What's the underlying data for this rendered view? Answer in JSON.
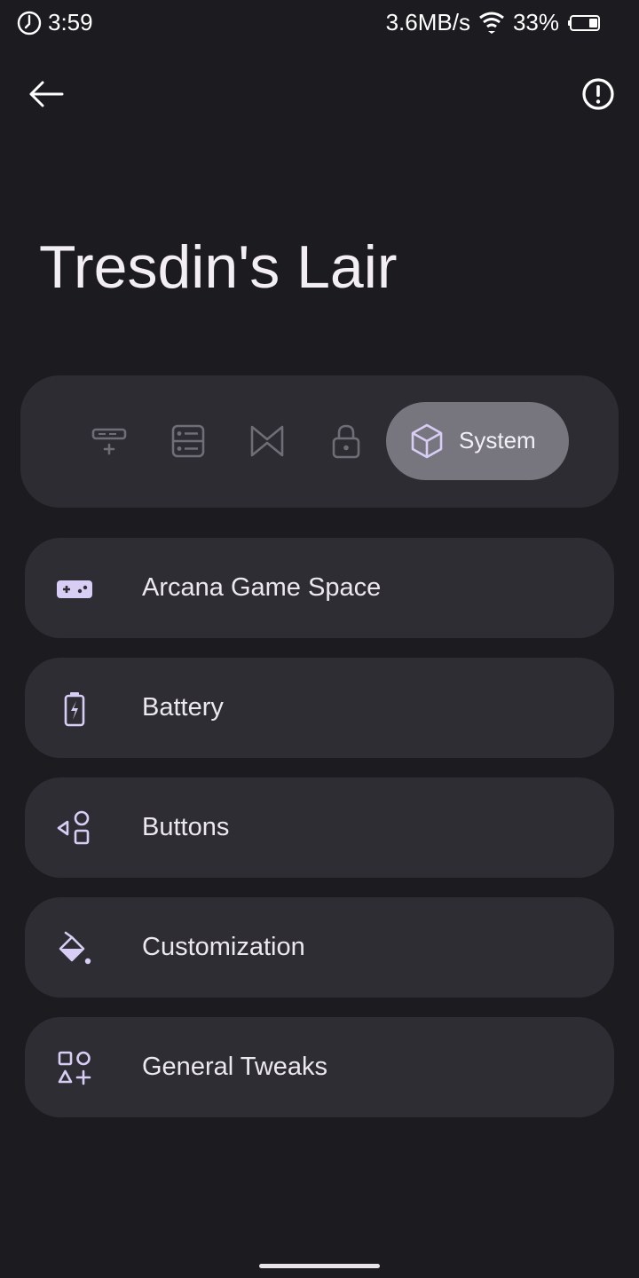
{
  "status_bar": {
    "time": "3:59",
    "network_speed": "3.6MB/s",
    "battery_percent": "33%",
    "battery_level": 0.33
  },
  "app_bar": {
    "back_icon": "arrow-left-icon",
    "info_icon": "info-circle-icon"
  },
  "page": {
    "title": "Tresdin's Lair"
  },
  "tabs": [
    {
      "icon": "display-add-icon"
    },
    {
      "icon": "server-stack-icon"
    },
    {
      "icon": "bowtie-icon"
    },
    {
      "icon": "lock-icon"
    },
    {
      "icon": "cube-icon",
      "label": "System",
      "selected": true
    }
  ],
  "menu": {
    "items": [
      {
        "label": "Arcana Game Space",
        "icon": "gamepad-icon"
      },
      {
        "label": "Battery",
        "icon": "battery-charging-icon"
      },
      {
        "label": "Buttons",
        "icon": "buttons-shapes-icon"
      },
      {
        "label": "Customization",
        "icon": "paint-bucket-icon"
      },
      {
        "label": "General Tweaks",
        "icon": "shapes-grid-icon"
      }
    ]
  },
  "colors": {
    "background": "#1c1b20",
    "card": "#2e2d33",
    "tab_strip": "#2d2c33",
    "tab_selected": "#77767e",
    "accent_icon": "#d8cdf5",
    "text_primary": "#ece8f0"
  }
}
